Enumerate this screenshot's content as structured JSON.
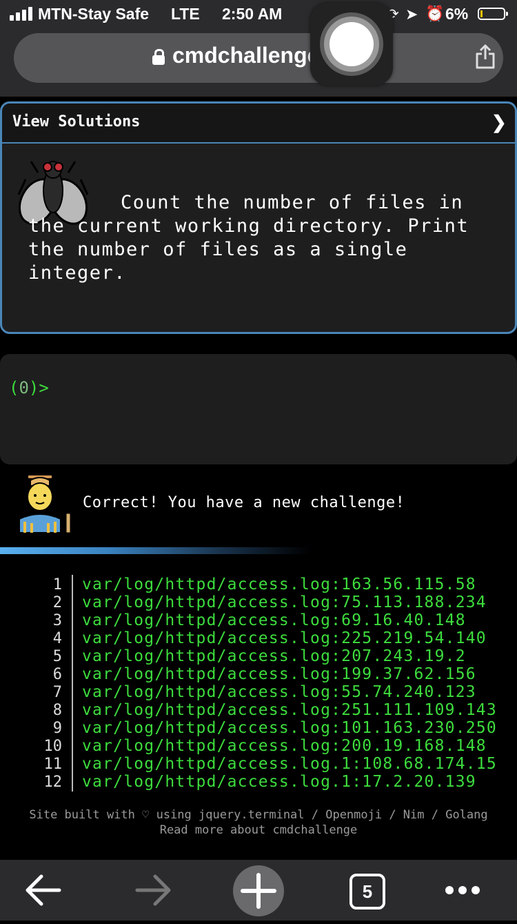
{
  "status_bar": {
    "carrier": "MTN-Stay Safe",
    "network": "LTE",
    "time": "2:50 AM",
    "battery": "6%",
    "battery_level": 0.06
  },
  "browser": {
    "url": "cmdchallenge",
    "tab_count": "5"
  },
  "challenge": {
    "view_solutions_label": "View Solutions",
    "chevron": "❯",
    "text": "Count the number of files in the current working directory. Print the number of files as a single integer."
  },
  "terminal": {
    "prompt_open": "(",
    "prompt_num": "0",
    "prompt_close": ")>"
  },
  "result": {
    "message": "Correct! You have a new challenge!"
  },
  "output_lines": [
    {
      "n": "1",
      "text": "var/log/httpd/access.log:163.56.115.58"
    },
    {
      "n": "2",
      "text": "var/log/httpd/access.log:75.113.188.234"
    },
    {
      "n": "3",
      "text": "var/log/httpd/access.log:69.16.40.148"
    },
    {
      "n": "4",
      "text": "var/log/httpd/access.log:225.219.54.140"
    },
    {
      "n": "5",
      "text": "var/log/httpd/access.log:207.243.19.2"
    },
    {
      "n": "6",
      "text": "var/log/httpd/access.log:199.37.62.156"
    },
    {
      "n": "7",
      "text": "var/log/httpd/access.log:55.74.240.123"
    },
    {
      "n": "8",
      "text": "var/log/httpd/access.log:251.111.109.143"
    },
    {
      "n": "9",
      "text": "var/log/httpd/access.log:101.163.230.250"
    },
    {
      "n": "10",
      "text": "var/log/httpd/access.log:200.19.168.148"
    },
    {
      "n": "11",
      "text": "var/log/httpd/access.log.1:108.68.174.15"
    },
    {
      "n": "12",
      "text": "var/log/httpd/access.log.1:17.2.20.139"
    }
  ],
  "footer": {
    "line1": "Site built with ♡ using jquery.terminal / Openmoji / Nim / Golang",
    "line2": "Read more about cmdchallenge"
  },
  "icons": {
    "lock": "lock-icon",
    "share": "share-icon",
    "fly": "fly-icon",
    "worker": "construction-worker-icon",
    "back": "back-arrow-icon",
    "forward": "forward-arrow-icon",
    "plus": "plus-icon",
    "tabs": "tabs-icon",
    "more": "more-dots-icon"
  },
  "colors": {
    "accent_border": "#4a86b8",
    "terminal_green": "#3ddc3d",
    "card_bg": "#1e1e1f",
    "chrome_bg": "#2b2b2d"
  }
}
